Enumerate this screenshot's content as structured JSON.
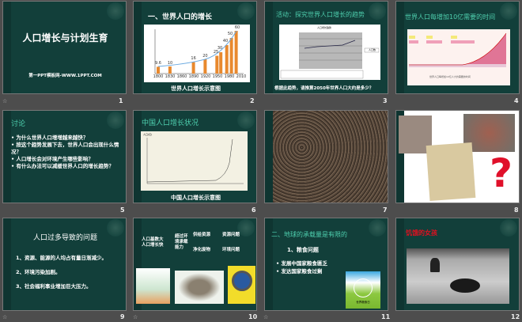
{
  "slides": [
    {
      "num": "1",
      "title": "人口增长与计划生育",
      "subtitle": "第一PPT模板网-WWW.1PPT.COM"
    },
    {
      "num": "2",
      "title": "一、世界人口的增长",
      "caption": "世界人口增长示意图",
      "chart_years": [
        "1800",
        "1830",
        "1860",
        "1890",
        "1920",
        "1950",
        "1980",
        "2010"
      ],
      "chart_values": [
        "9.6",
        "10",
        "16",
        "20",
        "25",
        "30",
        "40",
        "50",
        "60"
      ]
    },
    {
      "num": "3",
      "title": "活动：探究世界人口增长的趋势",
      "chart_title": "人口增长趋势",
      "legend": "人口数",
      "question": "根据此趋势，请推算2050年世界人口大约是多少？"
    },
    {
      "num": "4",
      "title": "世界人口每增加10亿需要的时间",
      "caption": "世界人口每增加10亿人大约需要的时间"
    },
    {
      "num": "5",
      "title": "讨论",
      "bullets": [
        "为什么世界人口增增越来越快？",
        "按这个趋势发展下去，世界人口会出现什么情况？",
        "人口增长会对环境产生哪些影响？",
        "有什么办法可以减缓世界人口的增长趋势？"
      ]
    },
    {
      "num": "6",
      "title": "中国人口增长状况",
      "caption": "中国人口增长示意图",
      "ylabel": "人口(亿)"
    },
    {
      "num": "7"
    },
    {
      "num": "8",
      "mark": "?"
    },
    {
      "num": "9",
      "title": "人口过多导致的问题",
      "items": [
        "1、资源、能源的人均占有量日渐减少。",
        "2、环境污染加剧。",
        "3、社会福利事业增加巨大压力。"
      ]
    },
    {
      "num": "10",
      "left": [
        "人口基数大",
        "人口增长快"
      ],
      "middle": [
        "超过环",
        "境承载",
        "能力"
      ],
      "a1": "供给资源",
      "a2": "净化废物",
      "r1": "资源问题",
      "r2": "环境问题"
    },
    {
      "num": "11",
      "title": "二、地球的承载量是有限的",
      "subtitle": "1、粮食问题",
      "bullets": [
        "发展中国家粮食匮乏",
        "发达国家粮食过剩"
      ],
      "logo": "世界粮食日"
    },
    {
      "num": "12",
      "title": "饥饿的女孩"
    }
  ],
  "colors": {
    "slide_bg": "#123f3a",
    "title_green": "#4ecfae"
  }
}
